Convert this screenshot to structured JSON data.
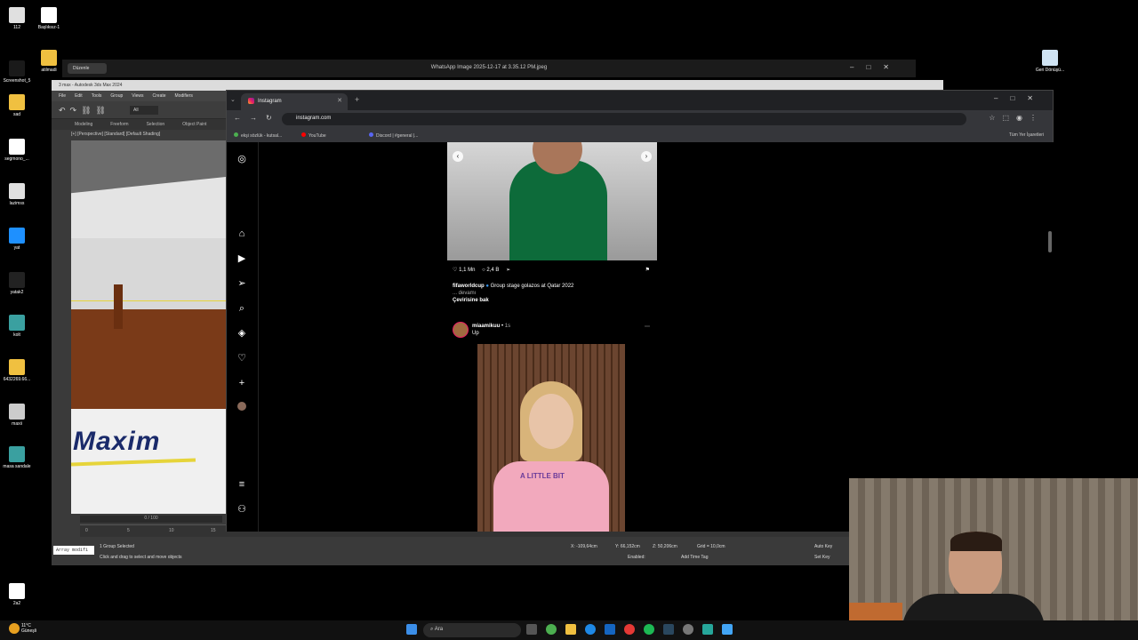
{
  "desktop": {
    "icons_left": [
      {
        "label": "112",
        "color": "#e0e0e0"
      },
      {
        "label": "Screenshot_5",
        "color": "#1a1a1a"
      },
      {
        "label": "sad",
        "color": "#f0c040"
      },
      {
        "label": "segmono_...",
        "color": "#ffffff"
      },
      {
        "label": "lazimss",
        "color": "#e0e0e0"
      },
      {
        "label": "yat",
        "color": "#1e90ff"
      },
      {
        "label": "yatak2",
        "color": "#222222"
      },
      {
        "label": "kolt",
        "color": "#3aa0a0"
      },
      {
        "label": "6432269.66...",
        "color": "#f0c040"
      },
      {
        "label": "maxii",
        "color": "#cccccc"
      },
      {
        "label": "masa sandale",
        "color": "#3aa0a0"
      },
      {
        "label": "2a2",
        "color": "#ffffff"
      }
    ],
    "icons_col2": [
      {
        "label": "Başlıksız-1",
        "color": "#ffffff"
      },
      {
        "label": "atilmadi",
        "color": "#f0c040"
      }
    ],
    "recycle_bin": "Geri Dönüşü..."
  },
  "photo_viewer": {
    "title": "WhatsApp Image 2025-12-17 at 3.35.12 PM.jpeg",
    "edit_label": "Düzenle"
  },
  "max": {
    "title": "3 max - Autodesk 3ds Max 2024",
    "menu": [
      "File",
      "Edit",
      "Tools",
      "Group",
      "Views",
      "Create",
      "Modifiers"
    ],
    "filter": "All",
    "ribbon": [
      "Modeling",
      "Freeform",
      "Selection",
      "Object Paint"
    ],
    "viewport_label": "[+] [Perspective] [Standard] [Default Shading]",
    "frame_counter": "0 / 100",
    "timeline_ticks": [
      "0",
      "5",
      "10",
      "15"
    ],
    "status_selected": "1 Group Selected",
    "status_hint": "Click and drag to select and move objects",
    "script_box": "Array modifi",
    "coord_x": "X: -109,64cm",
    "coord_y": "Y: 66,152cm",
    "coord_z": "Z: 50,206cm",
    "grid": "Grid = 10,0cm",
    "enabled": "Enabled:",
    "add_time_tag": "Add Time Tag",
    "auto_key": "Auto Key",
    "set_key": "Set Key",
    "selected": "Selec",
    "logo_text": "Maxim"
  },
  "chrome": {
    "tab_title": "Instagram",
    "url": "instagram.com",
    "bookmarks": [
      "ekşi sözlük - kutsal...",
      "YouTube",
      "Discord | #general |..."
    ],
    "all_bookmarks": "Tüm Yer İşaretleri"
  },
  "instagram": {
    "post1": {
      "likes": "1,1 Mn",
      "comments": "2,4 B",
      "username": "fifaworldcup",
      "caption": "Group stage golazos at Qatar 2022",
      "more": "... devamı",
      "translate": "Çevirisine bak"
    },
    "post2": {
      "username": "miaamikuu",
      "time": "1s",
      "subtitle": "Up",
      "shirt_text": "A LITTLE BIT"
    }
  },
  "taskbar": {
    "weather_temp": "11°C",
    "weather_desc": "Güneşli",
    "search_placeholder": "Ara"
  }
}
